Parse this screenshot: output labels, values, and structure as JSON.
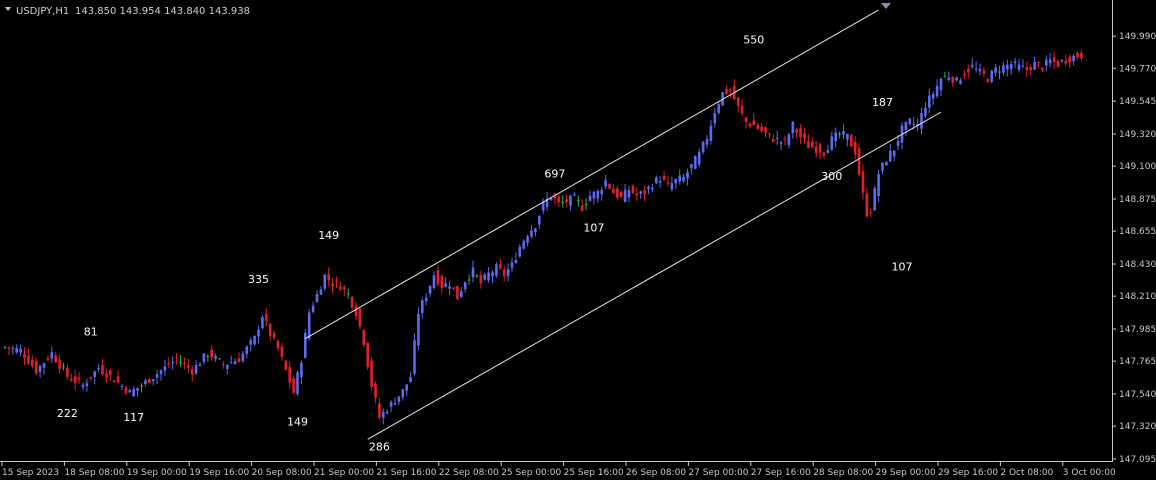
{
  "header": {
    "symbol": "USDJPY,H1",
    "ohlc": "143.850 143.954 143.840 143.938"
  },
  "colors": {
    "background": "#000000",
    "bull": "#5b6cf0",
    "bear": "#e0202a",
    "doji": "#2bb24a",
    "axis": "#c8c8c8",
    "channel": "#e6e6e6"
  },
  "chart_data": {
    "type": "candlestick",
    "ylim": [
      147.095,
      150.135
    ],
    "y_ticks": [
      "149.990",
      "149.770",
      "149.545",
      "149.320",
      "149.100",
      "148.875",
      "148.655",
      "148.430",
      "148.210",
      "147.985",
      "147.765",
      "147.540",
      "147.320",
      "147.095"
    ],
    "x_ticks": [
      {
        "label": "15 Sep 2023",
        "bar": 0
      },
      {
        "label": "18 Sep 08:00",
        "bar": 16
      },
      {
        "label": "19 Sep 00:00",
        "bar": 32
      },
      {
        "label": "19 Sep 16:00",
        "bar": 48
      },
      {
        "label": "20 Sep 08:00",
        "bar": 64
      },
      {
        "label": "21 Sep 00:00",
        "bar": 80
      },
      {
        "label": "21 Sep 16:00",
        "bar": 96
      },
      {
        "label": "22 Sep 08:00",
        "bar": 112
      },
      {
        "label": "25 Sep 00:00",
        "bar": 128
      },
      {
        "label": "25 Sep 16:00",
        "bar": 144
      },
      {
        "label": "26 Sep 08:00",
        "bar": 160
      },
      {
        "label": "27 Sep 00:00",
        "bar": 176
      },
      {
        "label": "27 Sep 16:00",
        "bar": 192
      },
      {
        "label": "28 Sep 08:00",
        "bar": 208
      },
      {
        "label": "29 Sep 00:00",
        "bar": 224
      },
      {
        "label": "29 Sep 16:00",
        "bar": 240
      },
      {
        "label": "2 Oct 08:00",
        "bar": 256
      },
      {
        "label": "3 Oct 00:00",
        "bar": 272
      }
    ],
    "close_path": [
      [
        0,
        147.86
      ],
      [
        4,
        147.84
      ],
      [
        8,
        147.7
      ],
      [
        12,
        147.82
      ],
      [
        16,
        147.66
      ],
      [
        20,
        147.6
      ],
      [
        24,
        147.72
      ],
      [
        28,
        147.64
      ],
      [
        32,
        147.55
      ],
      [
        35,
        147.6
      ],
      [
        40,
        147.7
      ],
      [
        44,
        147.78
      ],
      [
        48,
        147.7
      ],
      [
        52,
        147.82
      ],
      [
        56,
        147.74
      ],
      [
        60,
        147.78
      ],
      [
        64,
        147.92
      ],
      [
        66,
        148.08
      ],
      [
        68,
        147.95
      ],
      [
        70,
        147.85
      ],
      [
        72,
        147.7
      ],
      [
        74,
        147.55
      ],
      [
        76,
        147.78
      ],
      [
        78,
        148.1
      ],
      [
        80,
        148.22
      ],
      [
        82,
        148.35
      ],
      [
        84,
        148.3
      ],
      [
        86,
        148.28
      ],
      [
        88,
        148.22
      ],
      [
        90,
        148.1
      ],
      [
        92,
        147.9
      ],
      [
        94,
        147.6
      ],
      [
        96,
        147.38
      ],
      [
        98,
        147.44
      ],
      [
        100,
        147.5
      ],
      [
        102,
        147.56
      ],
      [
        104,
        147.66
      ],
      [
        106,
        148.1
      ],
      [
        108,
        148.22
      ],
      [
        110,
        148.36
      ],
      [
        112,
        148.28
      ],
      [
        114,
        148.3
      ],
      [
        116,
        148.2
      ],
      [
        118,
        148.32
      ],
      [
        120,
        148.38
      ],
      [
        122,
        148.3
      ],
      [
        124,
        148.36
      ],
      [
        126,
        148.4
      ],
      [
        128,
        148.36
      ],
      [
        130,
        148.42
      ],
      [
        132,
        148.55
      ],
      [
        134,
        148.64
      ],
      [
        136,
        148.7
      ],
      [
        138,
        148.84
      ],
      [
        140,
        148.9
      ],
      [
        142,
        148.84
      ],
      [
        144,
        148.86
      ],
      [
        146,
        148.88
      ],
      [
        148,
        148.82
      ],
      [
        150,
        148.9
      ],
      [
        152,
        148.92
      ],
      [
        154,
        149.0
      ],
      [
        156,
        148.92
      ],
      [
        158,
        148.88
      ],
      [
        160,
        148.94
      ],
      [
        162,
        148.9
      ],
      [
        164,
        148.92
      ],
      [
        166,
        148.98
      ],
      [
        168,
        149.02
      ],
      [
        170,
        148.96
      ],
      [
        172,
        149.0
      ],
      [
        174,
        149.02
      ],
      [
        176,
        149.1
      ],
      [
        178,
        149.18
      ],
      [
        180,
        149.3
      ],
      [
        182,
        149.48
      ],
      [
        184,
        149.6
      ],
      [
        186,
        149.62
      ],
      [
        188,
        149.5
      ],
      [
        190,
        149.4
      ],
      [
        192,
        149.38
      ],
      [
        194,
        149.34
      ],
      [
        196,
        149.3
      ],
      [
        198,
        149.28
      ],
      [
        200,
        149.26
      ],
      [
        202,
        149.38
      ],
      [
        204,
        149.3
      ],
      [
        206,
        149.24
      ],
      [
        208,
        149.22
      ],
      [
        210,
        149.2
      ],
      [
        212,
        149.28
      ],
      [
        214,
        149.32
      ],
      [
        216,
        149.3
      ],
      [
        218,
        149.2
      ],
      [
        220,
        148.9
      ],
      [
        221,
        148.78
      ],
      [
        222,
        148.8
      ],
      [
        224,
        149.05
      ],
      [
        226,
        149.15
      ],
      [
        228,
        149.22
      ],
      [
        230,
        149.35
      ],
      [
        232,
        149.4
      ],
      [
        234,
        149.38
      ],
      [
        236,
        149.52
      ],
      [
        238,
        149.6
      ],
      [
        240,
        149.7
      ],
      [
        242,
        149.72
      ],
      [
        244,
        149.68
      ],
      [
        246,
        149.74
      ],
      [
        248,
        149.78
      ],
      [
        250,
        149.74
      ],
      [
        252,
        149.7
      ],
      [
        254,
        149.76
      ],
      [
        256,
        149.78
      ],
      [
        258,
        149.8
      ],
      [
        260,
        149.78
      ],
      [
        262,
        149.76
      ],
      [
        264,
        149.8
      ],
      [
        266,
        149.78
      ],
      [
        268,
        149.82
      ],
      [
        270,
        149.8
      ],
      [
        272,
        149.83
      ],
      [
        274,
        149.85
      ],
      [
        276,
        149.86
      ]
    ],
    "swings": [
      {
        "label": "81",
        "bar": 22,
        "price": 147.9,
        "pos": "above"
      },
      {
        "label": "222",
        "bar": 16,
        "price": 147.48,
        "pos": "below"
      },
      {
        "label": "117",
        "bar": 33,
        "price": 147.45,
        "pos": "below"
      },
      {
        "label": "335",
        "bar": 65,
        "price": 148.26,
        "pos": "above"
      },
      {
        "label": "149",
        "bar": 75,
        "price": 147.42,
        "pos": "below"
      },
      {
        "label": "149",
        "bar": 83,
        "price": 148.56,
        "pos": "above"
      },
      {
        "label": "286",
        "bar": 96,
        "price": 147.25,
        "pos": "below"
      },
      {
        "label": "697",
        "bar": 141,
        "price": 148.98,
        "pos": "above"
      },
      {
        "label": "107",
        "bar": 151,
        "price": 148.75,
        "pos": "below"
      },
      {
        "label": "550",
        "bar": 192,
        "price": 149.9,
        "pos": "above"
      },
      {
        "label": "300",
        "bar": 212,
        "price": 149.1,
        "pos": "below"
      },
      {
        "label": "187",
        "bar": 225,
        "price": 149.47,
        "pos": "above"
      },
      {
        "label": "107",
        "bar": 230,
        "price": 148.48,
        "pos": "below"
      }
    ],
    "channels": [
      {
        "from": [
          77,
          147.92
        ],
        "to": [
          224,
          150.17
        ]
      },
      {
        "from": [
          93,
          147.23
        ],
        "to": [
          240,
          149.47
        ]
      }
    ]
  }
}
